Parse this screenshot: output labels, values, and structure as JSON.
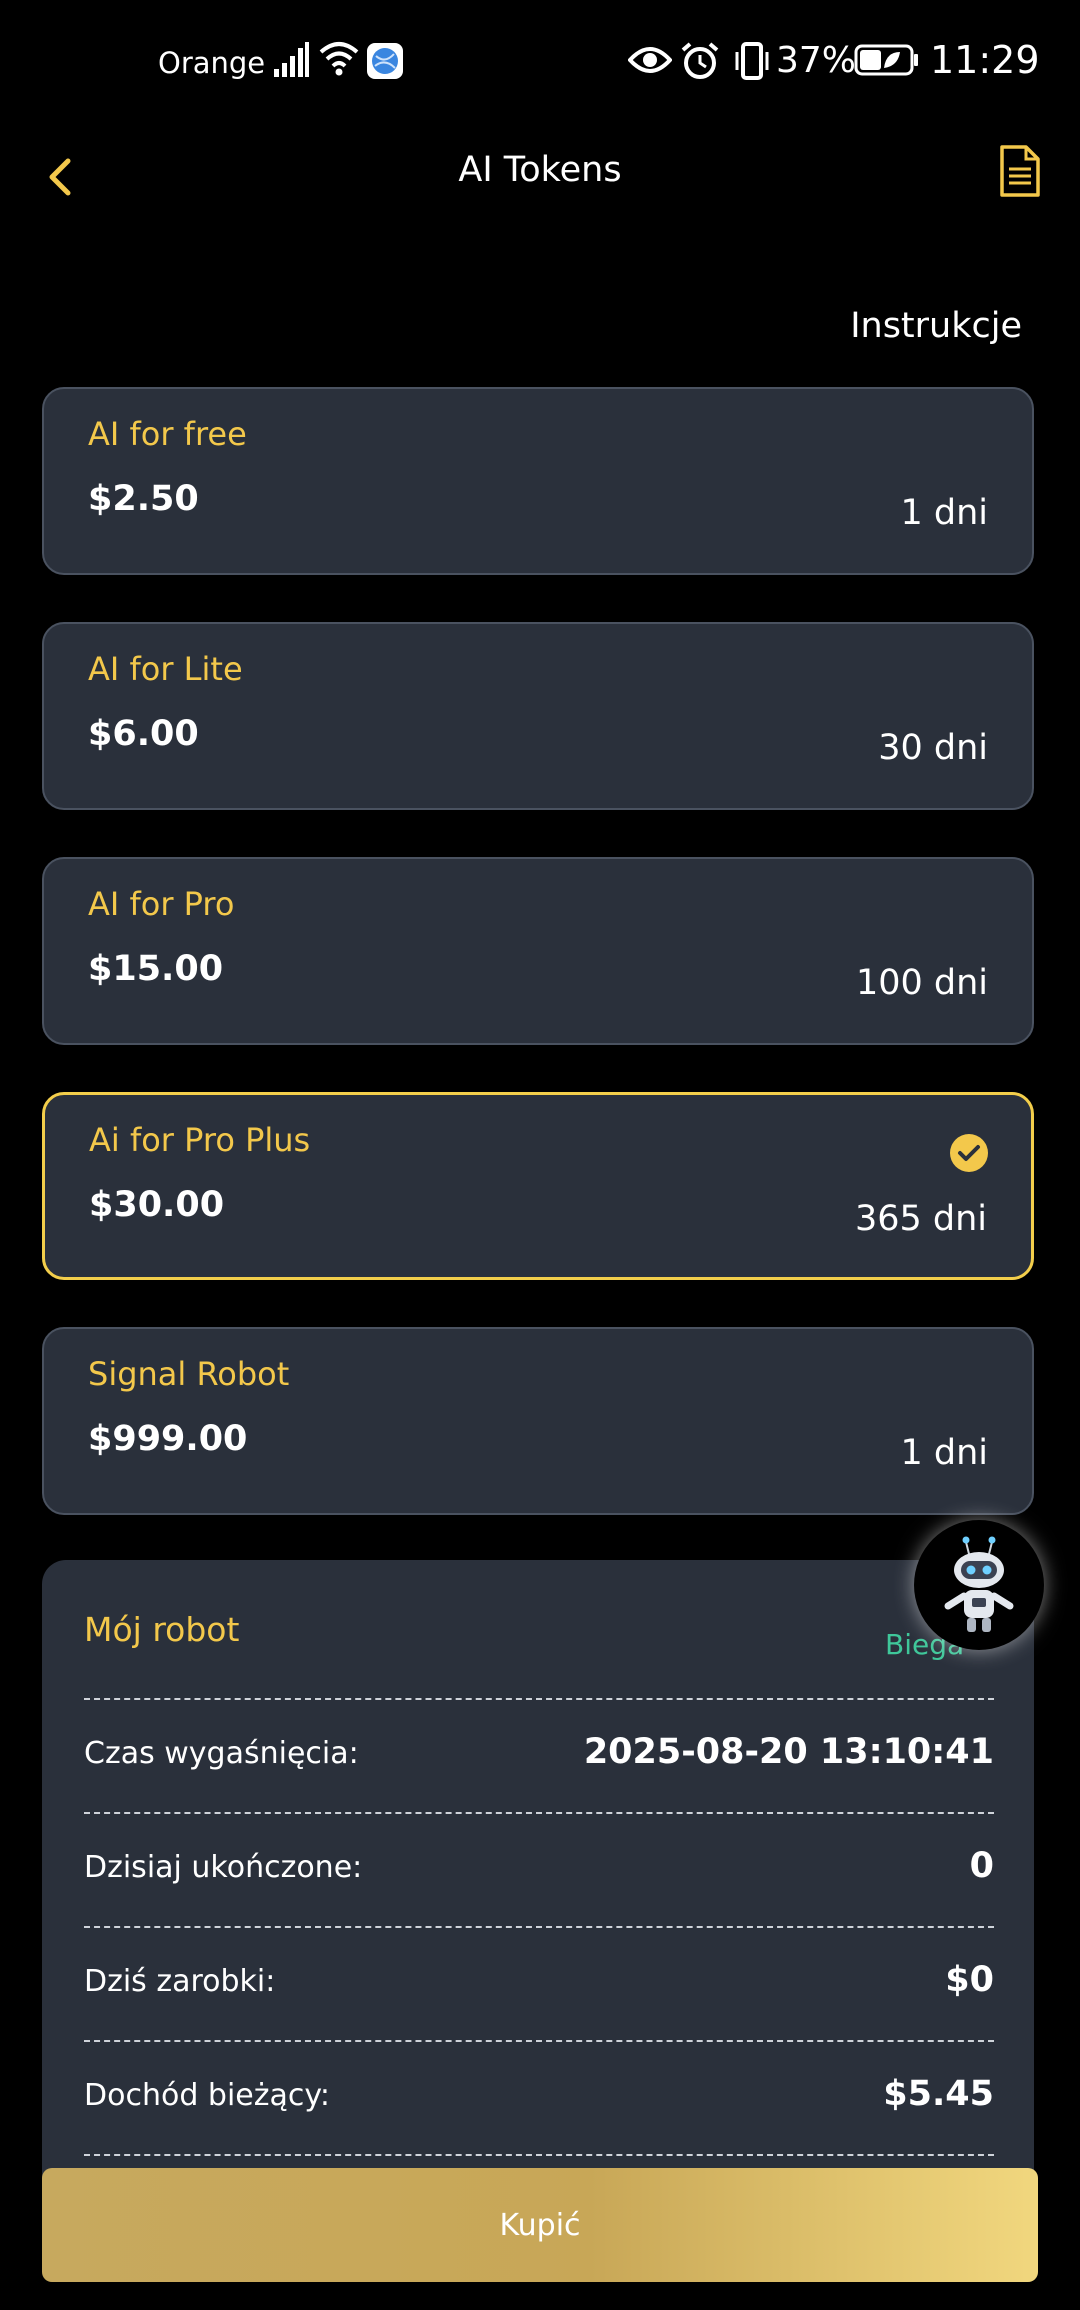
{
  "status_bar": {
    "carrier": "Orange",
    "battery_percent": "37%",
    "time": "11:29",
    "icons": [
      "signal-icon",
      "wifi-icon",
      "browser-icon",
      "eye-icon",
      "alarm-icon",
      "vibrate-icon",
      "battery-icon"
    ]
  },
  "header": {
    "title": "AI Tokens",
    "back_icon": "chevron-left-icon",
    "doc_icon": "document-icon"
  },
  "instructions_label": "Instrukcje",
  "plans": [
    {
      "name": "AI for free",
      "price": "$2.50",
      "duration": "1 dni",
      "selected": false
    },
    {
      "name": "AI for Lite",
      "price": "$6.00",
      "duration": "30 dni",
      "selected": false
    },
    {
      "name": "AI for Pro",
      "price": "$15.00",
      "duration": "100 dni",
      "selected": false
    },
    {
      "name": "Ai for Pro Plus",
      "price": "$30.00",
      "duration": "365 dni",
      "selected": true
    },
    {
      "name": "Signal Robot",
      "price": "$999.00",
      "duration": "1 dni",
      "selected": false
    }
  ],
  "robot": {
    "title": "Mój robot",
    "status": "Biega",
    "rows": [
      {
        "label": "Czas wygaśnięcia:",
        "value": "2025-08-20 13:10:41"
      },
      {
        "label": "Dzisiaj ukończone:",
        "value": "0"
      },
      {
        "label": "Dziś zarobki:",
        "value": "$0"
      },
      {
        "label": "Dochód bieżący:",
        "value": "$5.45"
      }
    ]
  },
  "buy_button_label": "Kupić",
  "colors": {
    "background": "#000000",
    "card": "#2a303b",
    "card_border": "#4a5260",
    "accent_gold": "#f3c84b",
    "status_green": "#3fc79a"
  }
}
